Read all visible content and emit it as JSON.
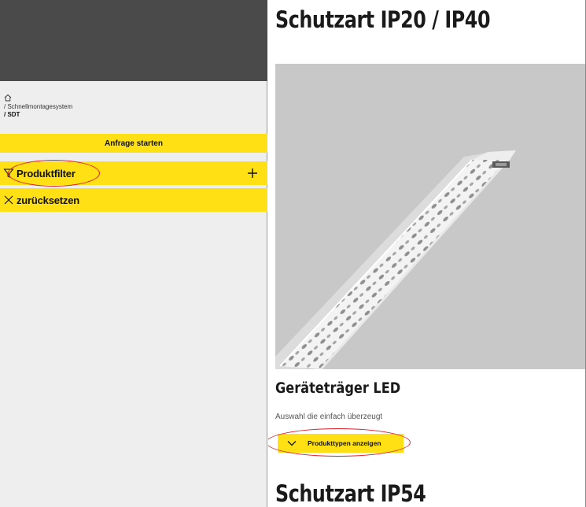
{
  "sidebar": {
    "breadcrumb": {
      "home_icon": "home-icon",
      "items": [
        "/ Schnellmontagesystem",
        "/ SDT"
      ]
    },
    "inquiry_button": "Anfrage starten",
    "filter": {
      "label": "Produktfilter",
      "icon": "funnel-icon",
      "expand_icon": "plus-icon"
    },
    "reset": {
      "label": "zurücksetzen",
      "icon": "close-icon"
    }
  },
  "main": {
    "section_title": "Schutzart IP20 / IP40",
    "product": {
      "name": "Geräteträger LED",
      "description": "Auswahl die einfach überzeugt",
      "types_button": "Produkttypen anzeigen"
    },
    "next_section_title": "Schutzart IP54"
  },
  "colors": {
    "accent_yellow": "#ffe014",
    "sidebar_header": "#4a4a4a",
    "sidebar_bg": "#eeeeee",
    "annotation_red": "#e0202a"
  }
}
